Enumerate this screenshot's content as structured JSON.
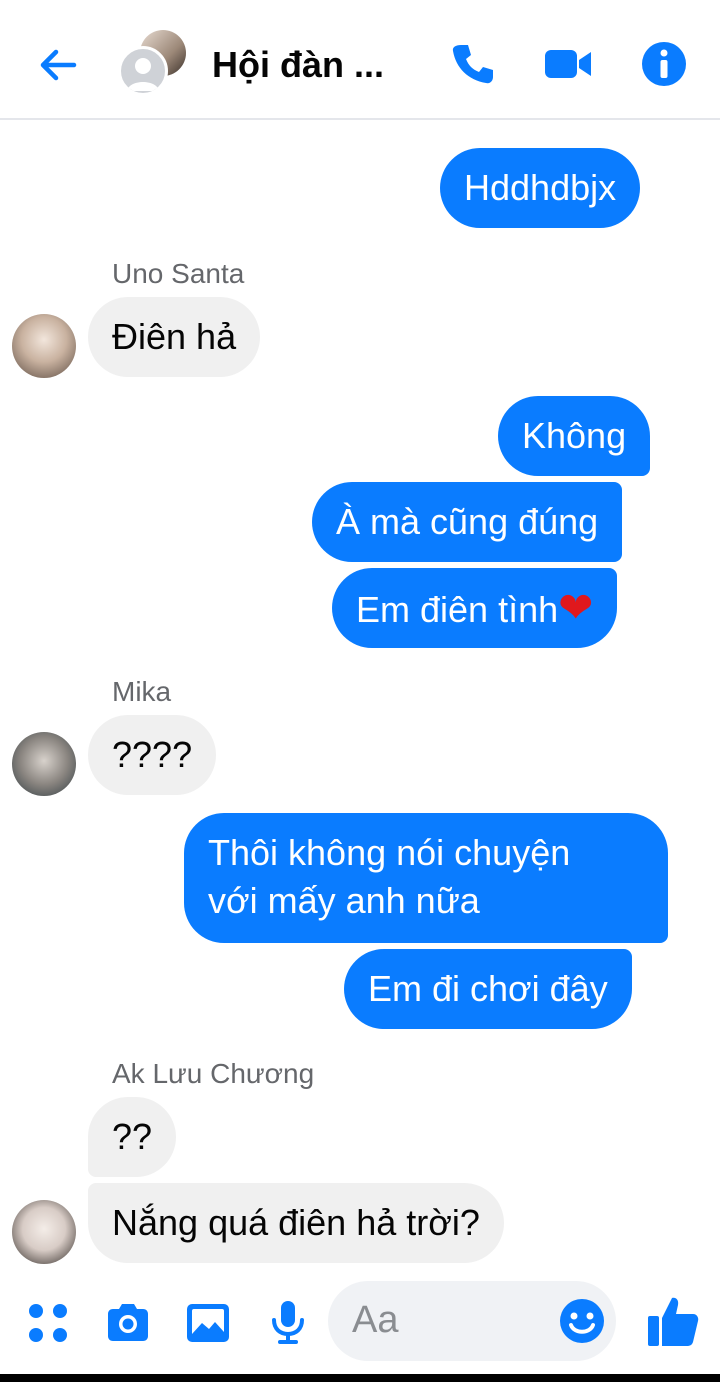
{
  "header": {
    "title": "Hội đàn ...",
    "accent": "#0a7cff"
  },
  "messages": [
    {
      "text": "Hddhdbjx",
      "from": "me"
    },
    {
      "sender": "Uno Santa",
      "text": "Điên hả"
    },
    {
      "text": "Không",
      "from": "me"
    },
    {
      "text": "À mà cũng đúng",
      "from": "me"
    },
    {
      "text": "Em điên tình",
      "emoji": "❤",
      "from": "me"
    },
    {
      "sender": "Mika",
      "text": "????"
    },
    {
      "line1": "Thôi không nói chuyện",
      "line2": "với mấy anh nữa",
      "from": "me"
    },
    {
      "text": "Em đi chơi đây",
      "from": "me"
    },
    {
      "sender": "Ak Lưu Chương",
      "text": "??"
    },
    {
      "text": "Nắng quá điên hả trời?"
    }
  ],
  "composer": {
    "placeholder": "Aa"
  }
}
